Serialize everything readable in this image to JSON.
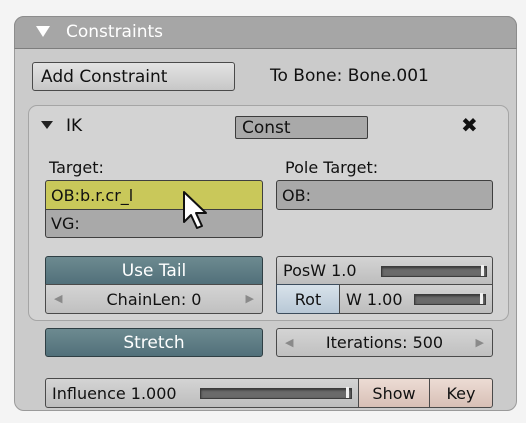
{
  "panel": {
    "title": "Constraints"
  },
  "toolbar": {
    "add_label": "Add Constraint",
    "to_bone": "To Bone: Bone.001"
  },
  "ik": {
    "name": "IK",
    "type_value": "Const",
    "close_symbol": "✖",
    "target_label": "Target:",
    "pole_label": "Pole Target:",
    "target_ob": "OB:b.r.cr_l",
    "target_vg": "VG:",
    "pole_ob": "OB:",
    "use_tail": "Use Tail",
    "chainlen": "ChainLen: 0",
    "stretch": "Stretch",
    "posw_label": "PosW 1.0",
    "posw_level": 1.0,
    "rot_label": "Rot",
    "w_label": "W 1.00",
    "w_level": 1.0,
    "iterations": "Iterations: 500"
  },
  "footer": {
    "influence_label": "Influence 1.000",
    "influence_level": 1.0,
    "show_label": "Show",
    "key_label": "Key"
  },
  "icons": {
    "header": "triangle-down-icon",
    "ik_collapse": "triangle-down-icon",
    "close": "close-icon",
    "cursor": "mouse-pointer-icon"
  },
  "colors": {
    "highlight_field": "#c9c85a",
    "accent_button": "#5f7d85",
    "header": "#a6a6a6"
  }
}
